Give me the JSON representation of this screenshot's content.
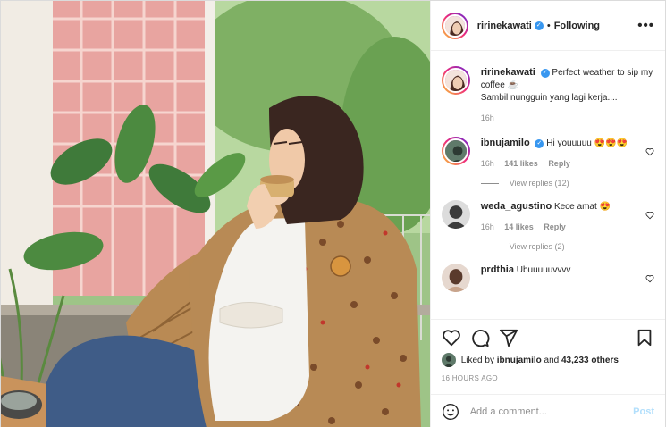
{
  "header": {
    "username": "ririnekawati",
    "separator": "•",
    "follow_status": "Following",
    "more": "•••"
  },
  "caption": {
    "username": "ririnekawati",
    "text": "Perfect weather to sip my coffee",
    "emoji": "☕",
    "line2": "Sambil nungguin yang lagi kerja....",
    "time": "16h"
  },
  "comments": [
    {
      "username": "ibnujamilo",
      "verified": true,
      "text": "Hi youuuuu 😍😍😍",
      "time": "16h",
      "likes": "141 likes",
      "reply": "Reply",
      "view_replies": "View replies (12)"
    },
    {
      "username": "weda_agustino",
      "verified": false,
      "text": "Kece amat 😍",
      "time": "16h",
      "likes": "14 likes",
      "reply": "Reply",
      "view_replies": "View replies (2)"
    },
    {
      "username": "prdthia",
      "verified": false,
      "text": "Ubuuuuuvvvv"
    }
  ],
  "likes": {
    "prefix": "Liked by",
    "user": "ibnujamilo",
    "conj": "and",
    "others": "43,233 others"
  },
  "timestamp": "16 HOURS AGO",
  "add_comment": {
    "placeholder": "Add a comment...",
    "post_label": "Post"
  },
  "icons": {
    "like": "heart-icon",
    "comment": "comment-icon",
    "share": "paper-plane-icon",
    "save": "bookmark-icon",
    "emoji": "smiley-icon"
  },
  "colors": {
    "verified": "#3897f0",
    "post_disabled": "#b2dffc",
    "meta": "#8e8e8e"
  }
}
